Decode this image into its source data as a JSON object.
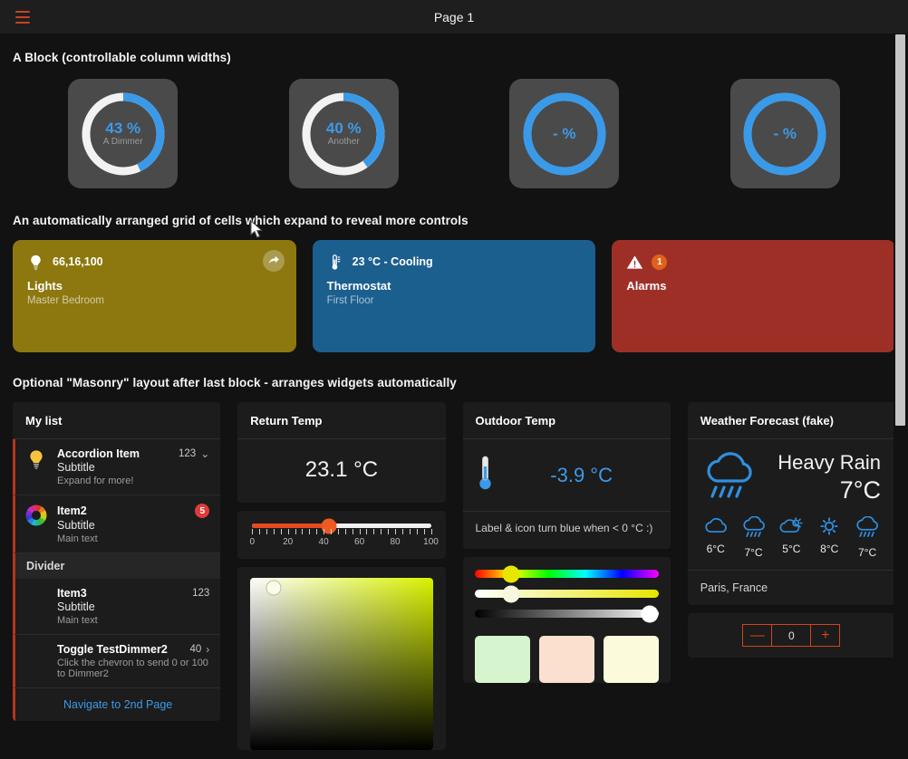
{
  "titlebar": {
    "menu_icon": "hamburger-menu-icon",
    "title": "Page 1"
  },
  "sections": {
    "block_heading": "A Block (controllable column widths)",
    "grid_heading": "An automatically arranged grid of cells which expand to reveal more controls",
    "masonry_heading": "Optional \"Masonry\" layout after last block - arranges widgets automatically"
  },
  "gauges": [
    {
      "value": "43 %",
      "label": "A Dimmer",
      "percent": 43,
      "arc_color": "#3b9ae8",
      "track_color": "#f2f2f2"
    },
    {
      "value": "40 %",
      "label": "Another",
      "percent": 40,
      "arc_color": "#3b9ae8",
      "track_color": "#f2f2f2"
    },
    {
      "value": "- %",
      "label": "",
      "percent": 100,
      "arc_color": "#3b9ae8",
      "track_color": "#3b9ae8"
    },
    {
      "value": "- %",
      "label": "",
      "percent": 100,
      "arc_color": "#3b9ae8",
      "track_color": "#3b9ae8"
    }
  ],
  "cards": [
    {
      "icon": "lightbulb-icon",
      "status": "66,16,100",
      "title": "Lights",
      "subtitle": "Master Bedroom",
      "color": "#8d7810",
      "action_icon": "arrow-share-icon",
      "has_action": true,
      "has_badge": false,
      "badge": ""
    },
    {
      "icon": "thermometer-icon",
      "status": "23 °C - Cooling",
      "title": "Thermostat",
      "subtitle": "First Floor",
      "color": "#1b5f8f",
      "action_icon": "",
      "has_action": false,
      "has_badge": false,
      "badge": ""
    },
    {
      "icon": "warning-triangle-icon",
      "status": "",
      "title": "Alarms",
      "subtitle": "",
      "color": "#9e2f27",
      "action_icon": "",
      "has_action": false,
      "has_badge": true,
      "badge": "1"
    }
  ],
  "list_widget": {
    "header": "My list",
    "items": [
      {
        "icon": "lightbulb-icon",
        "title": "Accordion Item",
        "subtitle": "Subtitle",
        "main": "Expand for more!",
        "meta": "123",
        "chevron": "⌄",
        "has_chevron": true,
        "badge": "",
        "has_badge": false
      },
      {
        "icon": "color-wheel-icon",
        "title": "Item2",
        "subtitle": "Subtitle",
        "main": "Main text",
        "meta": "",
        "chevron": "",
        "has_chevron": false,
        "badge": "5",
        "has_badge": true
      }
    ],
    "divider_label": "Divider",
    "items2": [
      {
        "icon": "",
        "title": "Item3",
        "subtitle": "Subtitle",
        "main": "Main text",
        "meta": "123",
        "chevron": "",
        "has_chevron": false,
        "badge": "",
        "has_badge": false
      },
      {
        "icon": "",
        "title": "Toggle TestDimmer2",
        "subtitle": "",
        "main": "Click the chevron to send 0 or 100 to Dimmer2",
        "meta": "40",
        "chevron": "›",
        "has_chevron": true,
        "badge": "",
        "has_badge": false
      }
    ],
    "nav_link": "Navigate to 2nd Page"
  },
  "return_temp": {
    "header": "Return Temp",
    "value": "23.1 °C"
  },
  "tick_slider": {
    "value": 43,
    "labels": [
      "0",
      "20",
      "40",
      "60",
      "80",
      "100"
    ],
    "min": 0,
    "max": 100,
    "fill_color": "#e8491f",
    "knob_color": "#ef5a21"
  },
  "color_picker": {
    "handle_x_pct": 13,
    "handle_y_pct": 6,
    "hue_color": "#d9f200"
  },
  "outdoor_temp": {
    "header": "Outdoor Temp",
    "icon": "thermometer-icon",
    "value": "-3.9 °C",
    "value_color": "#3b9ae8",
    "note": "Label & icon turn blue when < 0 °C :)"
  },
  "hsv_sliders": [
    {
      "name": "hue-slider",
      "track": "hue",
      "pos_pct": 20,
      "knob_color": "#e6e600"
    },
    {
      "name": "saturation-slider",
      "track": "sat",
      "pos_pct": 20,
      "knob_color": "#f7f7e0"
    },
    {
      "name": "brightness-slider",
      "track": "bri",
      "pos_pct": 95,
      "knob_color": "#ffffff"
    }
  ],
  "swatches": [
    {
      "name": "swatch-mint",
      "color": "#d6f5ce"
    },
    {
      "name": "swatch-peach",
      "color": "#fbe0cf"
    },
    {
      "name": "swatch-cream",
      "color": "#fbfbdc"
    }
  ],
  "weather": {
    "header": "Weather Forecast (fake)",
    "condition": "Heavy Rain",
    "temp": "7°C",
    "main_icon": "rain-cloud-icon",
    "forecast": [
      {
        "icon": "cloud-icon",
        "temp": "6°C"
      },
      {
        "icon": "rain-cloud-icon",
        "temp": "7°C"
      },
      {
        "icon": "partly-cloudy-icon",
        "temp": "5°C"
      },
      {
        "icon": "sun-icon",
        "temp": "8°C"
      },
      {
        "icon": "rain-cloud-icon",
        "temp": "7°C"
      }
    ],
    "location": "Paris, France"
  },
  "stepper": {
    "minus_label": "—",
    "value": "0",
    "plus_label": "+",
    "color": "#d2451c"
  }
}
